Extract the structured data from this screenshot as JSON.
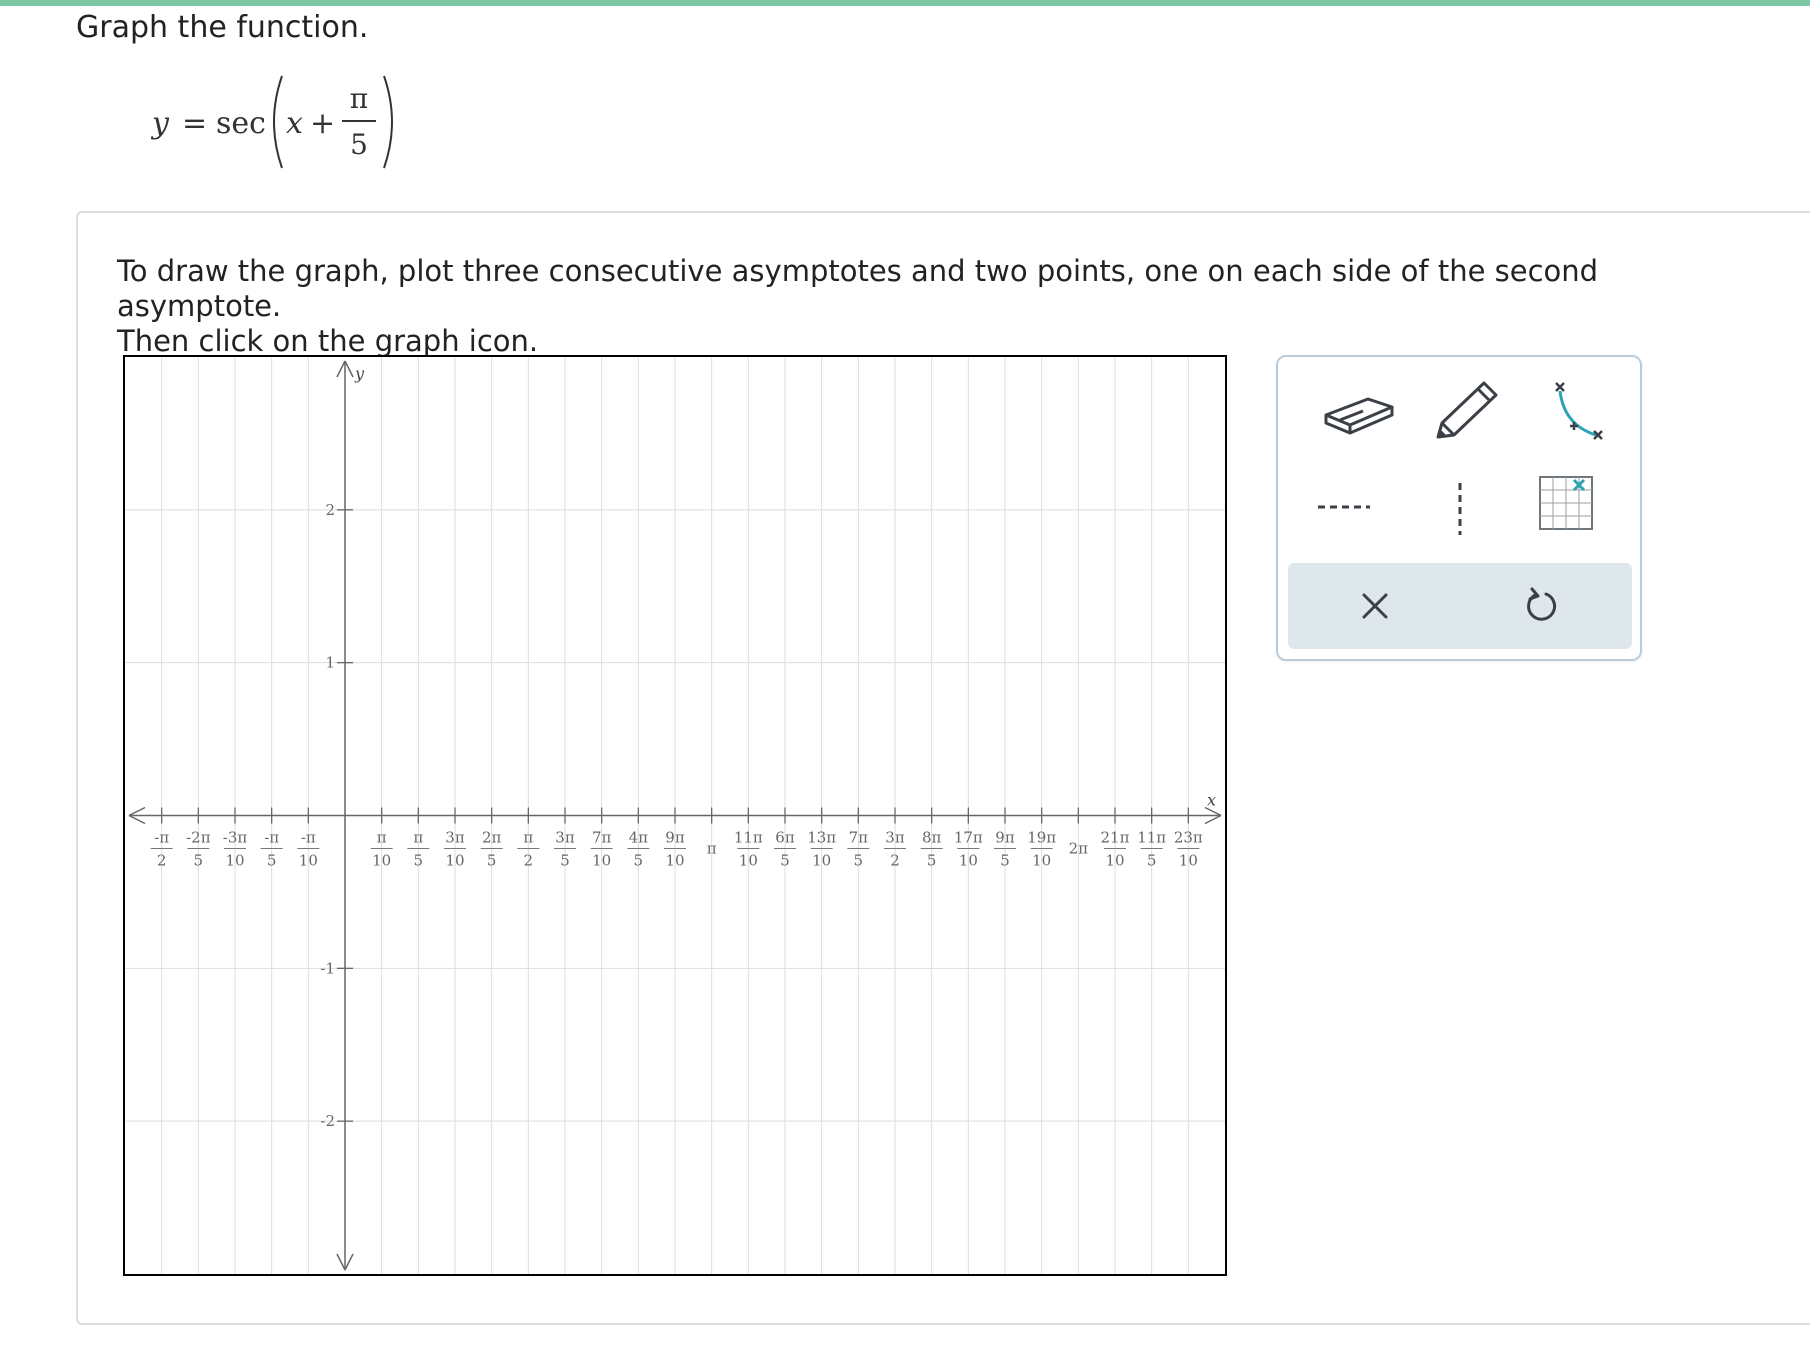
{
  "question": {
    "title": "Graph the function.",
    "equation": {
      "y": "y",
      "equals": "=",
      "func": "sec",
      "x": "x",
      "plus": "+",
      "numerator": "π",
      "denominator": "5"
    },
    "instructions_line1": "To draw the graph, plot three consecutive asymptotes and two points, one on each side of the second asymptote.",
    "instructions_line2": "Then click on the graph icon."
  },
  "graph": {
    "x_axis_label": "x",
    "y_axis_label": "y",
    "x_range_units_pi": [
      -0.6,
      2.4
    ],
    "y_range": [
      -3,
      3
    ],
    "x_grid_step_units_pi": 0.1,
    "y_grid_step": 1,
    "x_tick_labels": [
      {
        "v": -0.5,
        "num": "-π",
        "den": "2"
      },
      {
        "v": -0.4,
        "num": "-2π",
        "den": "5"
      },
      {
        "v": -0.3,
        "num": "-3π",
        "den": "10"
      },
      {
        "v": -0.2,
        "num": "-π",
        "den": "5"
      },
      {
        "v": -0.1,
        "num": "-π",
        "den": "10"
      },
      {
        "v": 0.1,
        "num": "π",
        "den": "10"
      },
      {
        "v": 0.2,
        "num": "π",
        "den": "5"
      },
      {
        "v": 0.3,
        "num": "3π",
        "den": "10"
      },
      {
        "v": 0.4,
        "num": "2π",
        "den": "5"
      },
      {
        "v": 0.5,
        "num": "π",
        "den": "2"
      },
      {
        "v": 0.6,
        "num": "3π",
        "den": "5"
      },
      {
        "v": 0.7,
        "num": "7π",
        "den": "10"
      },
      {
        "v": 0.8,
        "num": "4π",
        "den": "5"
      },
      {
        "v": 0.9,
        "num": "9π",
        "den": "10"
      },
      {
        "v": 1.0,
        "single": "π"
      },
      {
        "v": 1.1,
        "num": "11π",
        "den": "10"
      },
      {
        "v": 1.2,
        "num": "6π",
        "den": "5"
      },
      {
        "v": 1.3,
        "num": "13π",
        "den": "10"
      },
      {
        "v": 1.4,
        "num": "7π",
        "den": "5"
      },
      {
        "v": 1.5,
        "num": "3π",
        "den": "2"
      },
      {
        "v": 1.6,
        "num": "8π",
        "den": "5"
      },
      {
        "v": 1.7,
        "num": "17π",
        "den": "10"
      },
      {
        "v": 1.8,
        "num": "9π",
        "den": "5"
      },
      {
        "v": 1.9,
        "num": "19π",
        "den": "10"
      },
      {
        "v": 2.0,
        "single": "2π"
      },
      {
        "v": 2.1,
        "num": "21π",
        "den": "10"
      },
      {
        "v": 2.2,
        "num": "11π",
        "den": "5"
      },
      {
        "v": 2.3,
        "num": "23π",
        "den": "10"
      }
    ],
    "y_tick_labels": [
      {
        "v": 2,
        "label": "2"
      },
      {
        "v": 1,
        "label": "1"
      },
      {
        "v": -1,
        "label": "-1"
      },
      {
        "v": -2,
        "label": "-2"
      }
    ]
  },
  "toolbox": {
    "tools": [
      {
        "name": "eraser-tool",
        "icon": "eraser-icon"
      },
      {
        "name": "pencil-tool",
        "icon": "pencil-icon"
      },
      {
        "name": "secant-graph-tool",
        "icon": "secant-curve-icon"
      },
      {
        "name": "horizontal-asymptote-tool",
        "icon": "horizontal-dashed-line-icon"
      },
      {
        "name": "vertical-asymptote-tool",
        "icon": "vertical-dashed-line-icon"
      },
      {
        "name": "point-grid-tool",
        "icon": "grid-point-icon"
      }
    ],
    "actions": [
      {
        "name": "clear-button",
        "icon": "close-icon"
      },
      {
        "name": "undo-button",
        "icon": "undo-icon"
      }
    ]
  },
  "colors": {
    "accent_bar": "#7dc7a3",
    "toolbox_border": "#b9ccd8",
    "action_row": "#dde7ec",
    "icon_dark": "#3a4046",
    "icon_teal": "#2aa3b5"
  }
}
